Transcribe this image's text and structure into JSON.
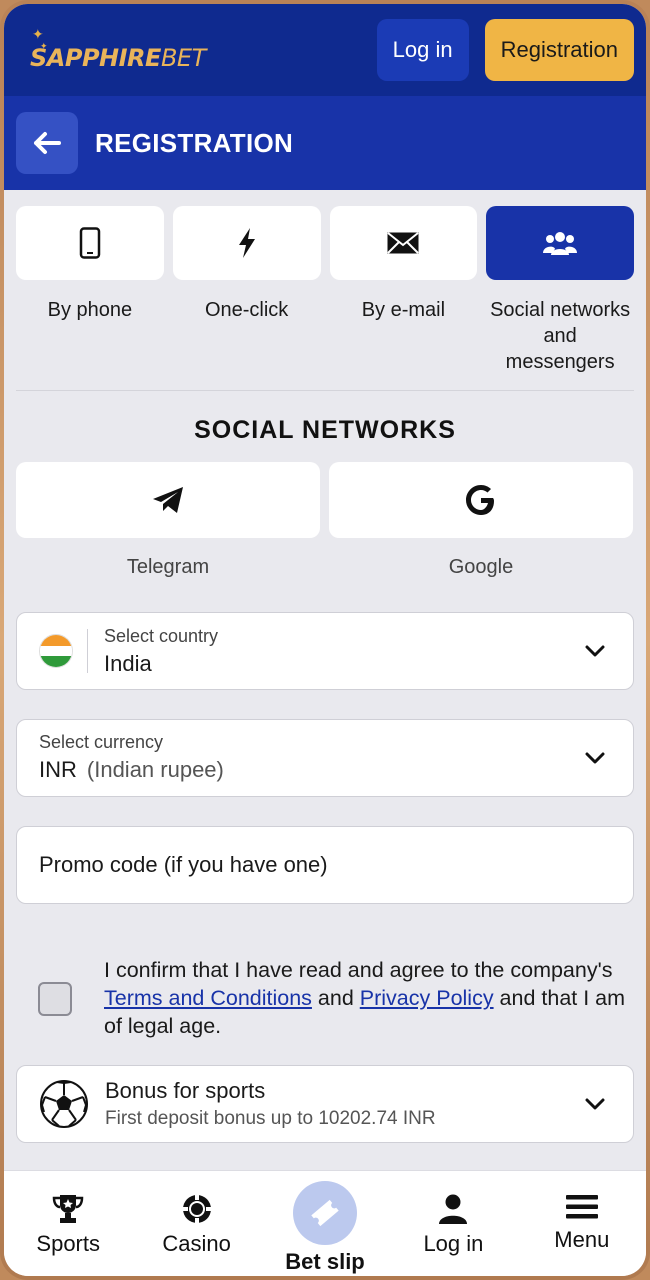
{
  "topbar": {
    "logo_main": "SAPPHIRE",
    "logo_bet": "BET",
    "login_label": "Log in",
    "register_label": "Registration"
  },
  "header": {
    "title": "REGISTRATION"
  },
  "methods": [
    {
      "label": "By phone",
      "icon": "phone-icon"
    },
    {
      "label": "One-click",
      "icon": "lightning-icon"
    },
    {
      "label": "By e-mail",
      "icon": "envelope-icon"
    },
    {
      "label": "Social networks and messengers",
      "icon": "users-icon",
      "active": true
    }
  ],
  "social": {
    "title": "SOCIAL NETWORKS",
    "items": [
      {
        "label": "Telegram",
        "icon": "telegram-icon"
      },
      {
        "label": "Google",
        "icon": "google-icon"
      }
    ]
  },
  "country": {
    "caption": "Select country",
    "value": "India",
    "flag": "india-flag"
  },
  "currency": {
    "caption": "Select currency",
    "code": "INR",
    "name": "(Indian rupee)"
  },
  "promo": {
    "placeholder": "Promo code (if you have one)"
  },
  "agreement": {
    "text_1": "I confirm that I have read and agree to the company's ",
    "terms_link": "Terms and Conditions",
    "text_2": " and ",
    "privacy_link": "Privacy Policy",
    "text_3": " and that I am of legal age."
  },
  "bonus": {
    "title": "Bonus for sports",
    "subtitle": "First deposit bonus up to 10202.74 INR"
  },
  "nav": {
    "sports": "Sports",
    "casino": "Casino",
    "betslip": "Bet slip",
    "login": "Log in",
    "menu": "Menu"
  },
  "colors": {
    "brand_dark": "#0f2a8f",
    "brand": "#1833a8",
    "accent": "#f0b545",
    "background": "#e9e9ee"
  }
}
